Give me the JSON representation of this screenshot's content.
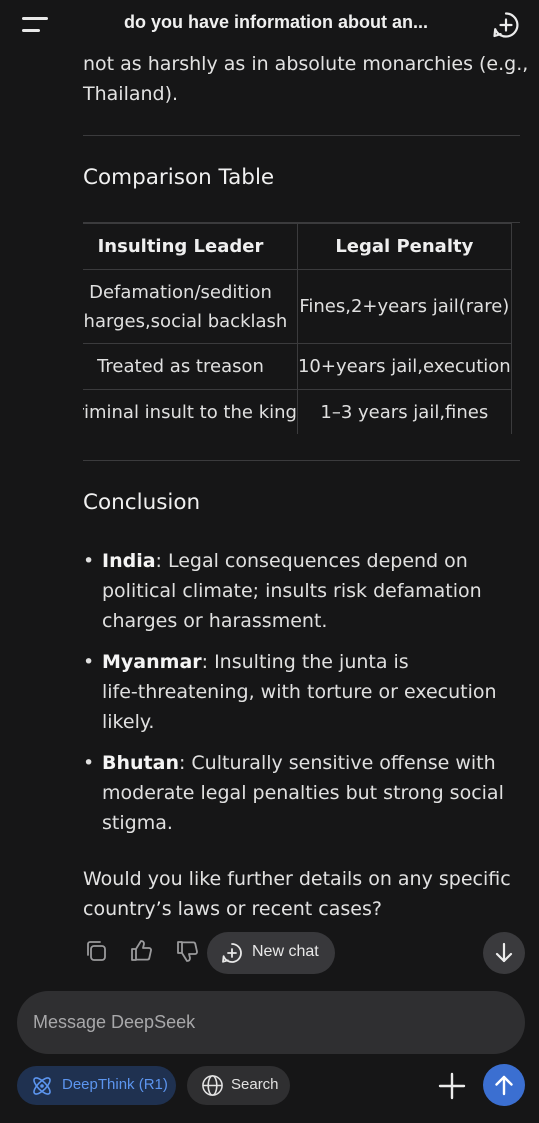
{
  "header": {
    "title": "do you have information about an...",
    "menu_icon": "hamburger-icon",
    "new_chat_icon": "plus-circle-icon"
  },
  "message": {
    "intro_lines": [
      "not as harshly as in absolute monarchies (e.g.,",
      "Thailand)."
    ],
    "comparison_heading": "Comparison Table",
    "table": {
      "headers": [
        "Insulting Leader",
        "Legal Penalty"
      ],
      "rows": [
        {
          "c1_lines": [
            "Defamation/sedition",
            "charges,social backlash"
          ],
          "c2": "Fines,2+years jail(rare)"
        },
        {
          "c1_lines": [
            "Treated as treason"
          ],
          "c2": "10+years jail,execution"
        },
        {
          "c1_lines": [
            "Criminal insult to the king"
          ],
          "c2": "1–3 years jail,fines"
        }
      ]
    },
    "conclusion_heading": "Conclusion",
    "conclusion_items": [
      {
        "bold": "India",
        "lines": [
          ": Legal consequences depend on",
          "political climate; insults risk defamation",
          "charges or harassment."
        ]
      },
      {
        "bold": "Myanmar",
        "lines": [
          ": Insulting the junta is",
          "life-threatening, with torture or execution",
          "likely."
        ]
      },
      {
        "bold": "Bhutan",
        "lines": [
          ": Culturally sensitive offense with",
          "moderate legal penalties but strong social",
          "stigma."
        ]
      }
    ],
    "followup_lines": [
      "Would you like further details on any specific",
      "country’s laws or recent cases?"
    ],
    "bullet_char": "•"
  },
  "actions": {
    "icons": [
      "copy-icon",
      "thumbs-up-icon",
      "thumbs-down-icon"
    ],
    "new_chat_label": "New chat",
    "scroll_icon": "arrow-down-icon"
  },
  "composer": {
    "placeholder": "Message DeepSeek",
    "deepthink_label": "DeepThink (R1)",
    "search_label": "Search",
    "accent_color": "#3b6fd1",
    "deepthink_text_color": "#5c95ef"
  }
}
